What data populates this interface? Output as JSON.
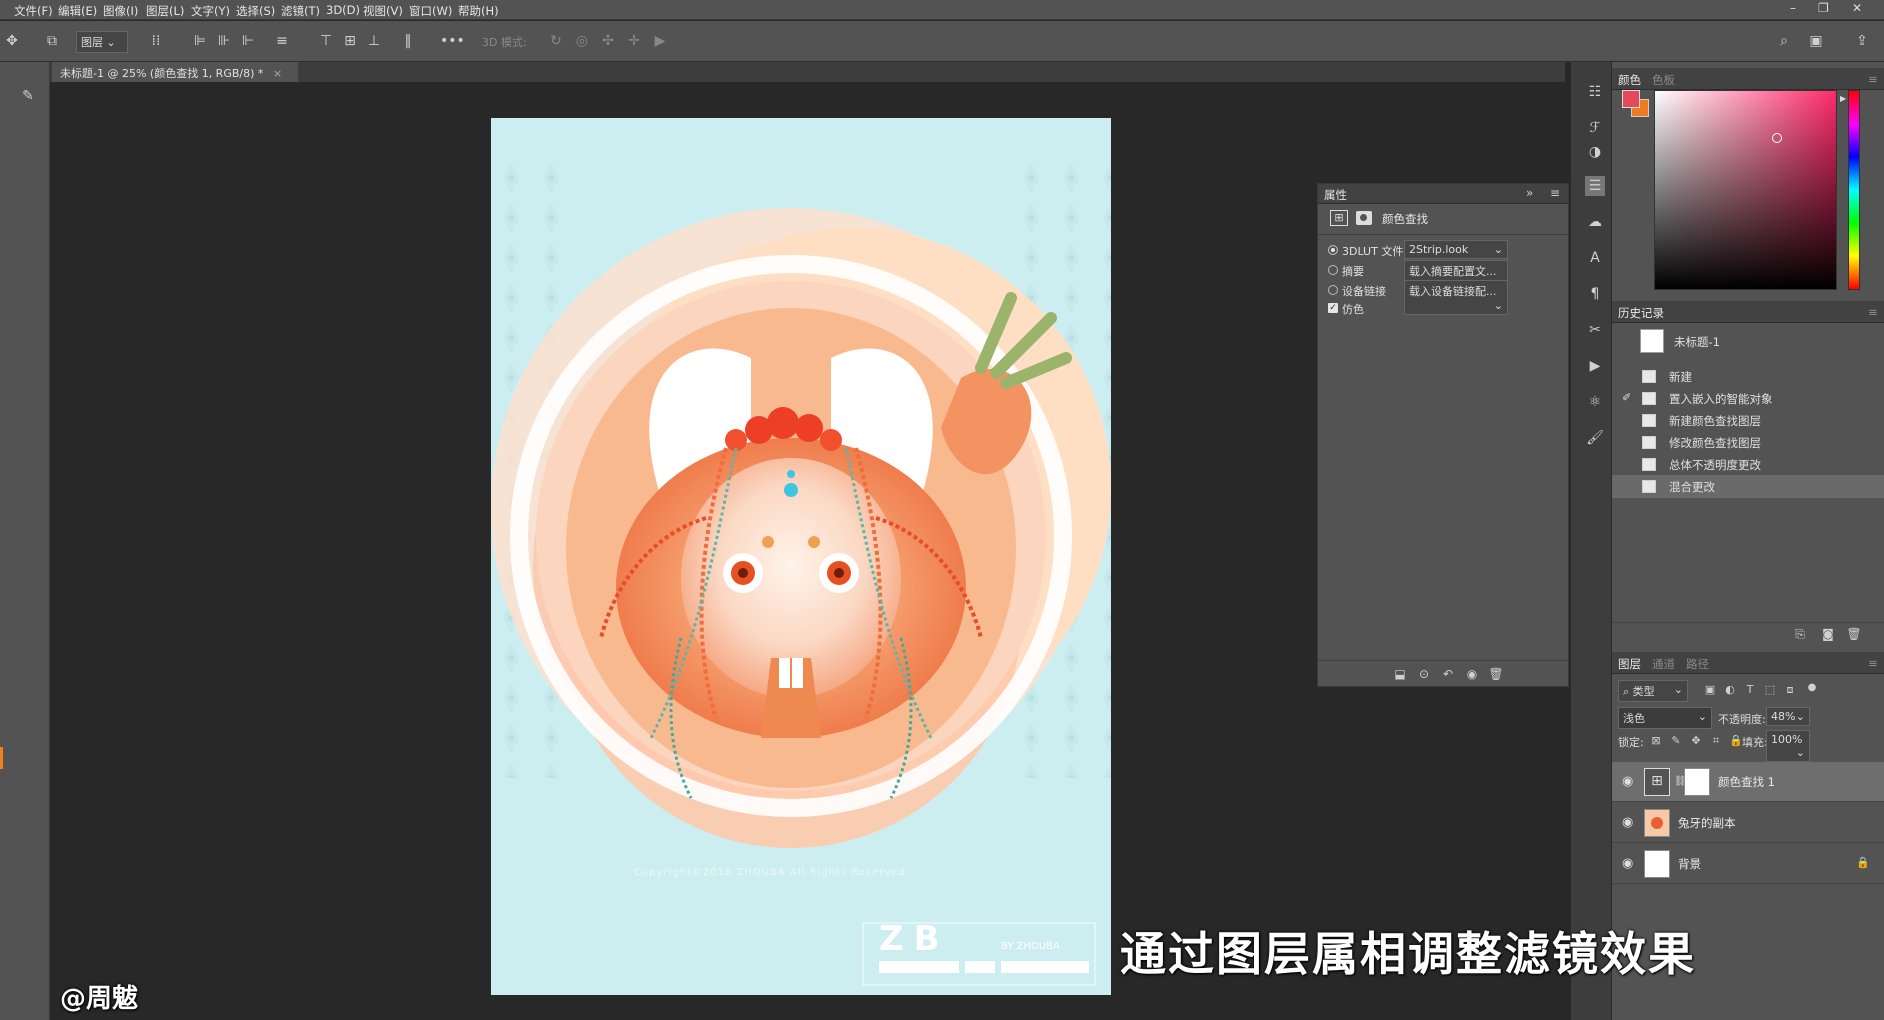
{
  "menubar": {
    "items": [
      "文件(F)",
      "编辑(E)",
      "图像(I)",
      "图层(L)",
      "文字(Y)",
      "选择(S)",
      "滤镜(T)",
      "3D(D)",
      "视图(V)",
      "窗口(W)",
      "帮助(H)"
    ]
  },
  "optbar": {
    "layer_select": "图层",
    "mode_label": "3D 模式:",
    "more": "•••"
  },
  "document": {
    "tab_title": "未标题-1 @ 25% (颜色查找 1, RGB/8) *",
    "close": "×"
  },
  "artwork": {
    "copyright": "Copyright©2018 ZHOUBA All Rights Reserved",
    "logo": "ZB",
    "logo_sub": "BY ZHOUBA"
  },
  "properties": {
    "title": "属性",
    "subtitle": "颜色查找",
    "rows": [
      {
        "label": "3DLUT 文件",
        "value": "2Strip.look",
        "checked": true
      },
      {
        "label": "摘要",
        "value": "载入摘要配置文...",
        "checked": false
      },
      {
        "label": "设备链接",
        "value": "载入设备链接配...",
        "checked": false
      }
    ],
    "dither_label": "仿色"
  },
  "color_panel": {
    "tab_active": "颜色",
    "tab_inactive": "色板",
    "fg": "#e8485c",
    "bg": "#f07a20",
    "field_hue": "#ff2a6a"
  },
  "history": {
    "title": "历史记录",
    "snapshot": "未标题-1",
    "items": [
      "新建",
      "置入嵌入的智能对象",
      "新建颜色查找图层",
      "修改颜色查找图层",
      "总体不透明度更改",
      "混合更改"
    ]
  },
  "layers": {
    "tabs": [
      "图层",
      "通道",
      "路径"
    ],
    "filter": "类型",
    "blend_mode": "浅色",
    "opacity_label": "不透明度:",
    "opacity": "48%",
    "lock_label": "锁定:",
    "fill_label": "填充:",
    "fill": "100%",
    "items": [
      {
        "name": "颜色查找 1"
      },
      {
        "name": "兔牙的副本"
      },
      {
        "name": "背景"
      }
    ]
  },
  "captions": {
    "watermark": "@周魃",
    "subtitle": "通过图层属相调整滤镜效果"
  }
}
